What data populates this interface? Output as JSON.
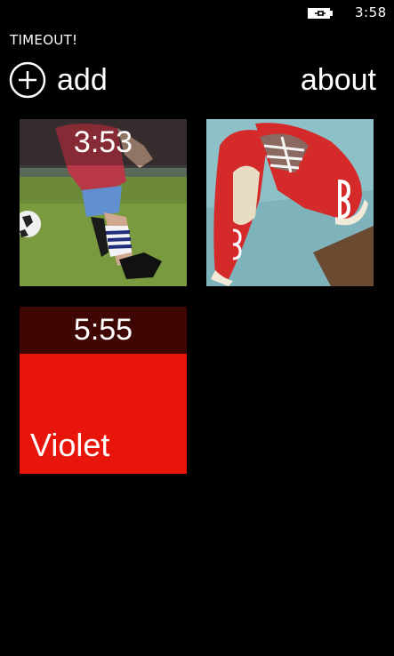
{
  "status_bar": {
    "time": "3:58",
    "battery_icon": "battery-charging-icon"
  },
  "app": {
    "title": "TIMEOUT!"
  },
  "header": {
    "add_label": "add",
    "add_icon": "plus-circle-icon",
    "about_label": "about"
  },
  "tiles": [
    {
      "time": "3:53",
      "image": "soccer-kid-photo"
    },
    {
      "time": "",
      "image": "red-shoes-photo"
    },
    {
      "time": "5:55",
      "name": "Violet",
      "color": "#e8160a",
      "banner_color": "#3e0703"
    }
  ]
}
